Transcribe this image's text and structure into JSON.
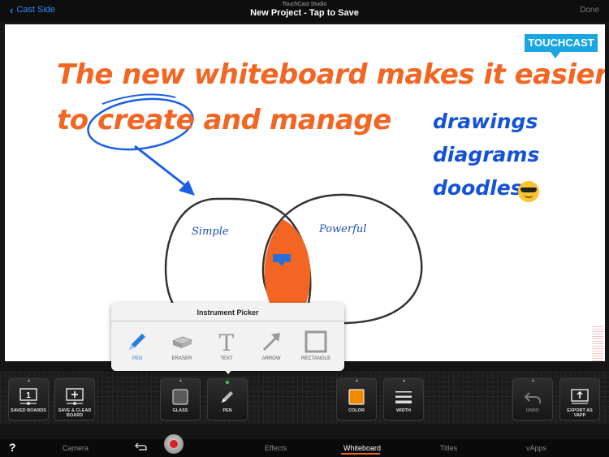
{
  "topbar": {
    "back_label": "Cast Side",
    "app_title": "TouchCast Studio",
    "project_title": "New Project - Tap to Save",
    "done_label": "Done"
  },
  "whiteboard": {
    "headline_line1": "The new whiteboard makes it easier",
    "headline_line2": "to create and manage",
    "list": [
      "drawings",
      "diagrams",
      "doodles"
    ],
    "venn_left_label": "Simple",
    "venn_right_label": "Powerful",
    "logo_text": "TOUCHCAST",
    "colors": {
      "headline": "#f26522",
      "list": "#1452d8",
      "annotation": "#1a5fe6",
      "logo": "#1aa6e0"
    }
  },
  "picker": {
    "title": "Instrument Picker",
    "tools": [
      {
        "label": "PEN",
        "icon": "pen-icon",
        "selected": true
      },
      {
        "label": "ERASER",
        "icon": "eraser-icon"
      },
      {
        "label": "TEXT",
        "icon": "text-icon"
      },
      {
        "label": "ARROW",
        "icon": "arrow-icon"
      },
      {
        "label": "RECTANGLE",
        "icon": "rectangle-icon"
      }
    ]
  },
  "toolbar": {
    "saved_boards": {
      "label": "SAVED BOARDS",
      "count": "1"
    },
    "save_clear": {
      "label": "SAVE & CLEAR BOARD"
    },
    "glass": {
      "label": "GLASS"
    },
    "pen": {
      "label": "PEN"
    },
    "color": {
      "label": "COLOR",
      "value": "#f28a00"
    },
    "width": {
      "label": "WIDTH"
    },
    "undo": {
      "label": "UNDO"
    },
    "export": {
      "label": "EXPORT AS VAPP"
    }
  },
  "tabs": {
    "help": "?",
    "items": [
      "Camera",
      "Effects",
      "Whiteboard",
      "Titles",
      "vApps"
    ],
    "active": "Whiteboard",
    "accent": "#f26522"
  }
}
